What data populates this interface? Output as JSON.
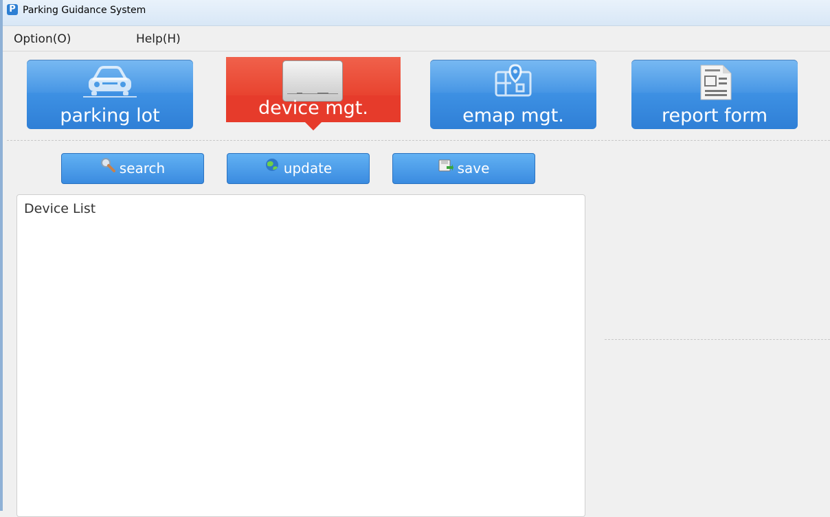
{
  "window": {
    "title": "Parking Guidance System",
    "app_icon_letter": "P"
  },
  "menu": {
    "option": "Option(O)",
    "help": "Help(H)"
  },
  "nav": {
    "parking_lot": "parking lot",
    "device_mgt": "device mgt.",
    "emap_mgt": "emap mgt.",
    "report_form": "report form",
    "active": "device mgt."
  },
  "toolbar": {
    "search": "search",
    "update": "update",
    "save": "save"
  },
  "panel": {
    "title": "Device List"
  },
  "colors": {
    "nav_blue": "#3d90e3",
    "nav_active_red": "#e63b2b",
    "window_bg": "#f0f0f0"
  },
  "icons": {
    "parking_lot": "car-icon",
    "device_mgt": "device-box-icon",
    "emap_mgt": "map-pin-icon",
    "report_form": "document-icon",
    "search": "magnifier-icon",
    "update": "globe-refresh-icon",
    "save": "save-disk-icon"
  }
}
